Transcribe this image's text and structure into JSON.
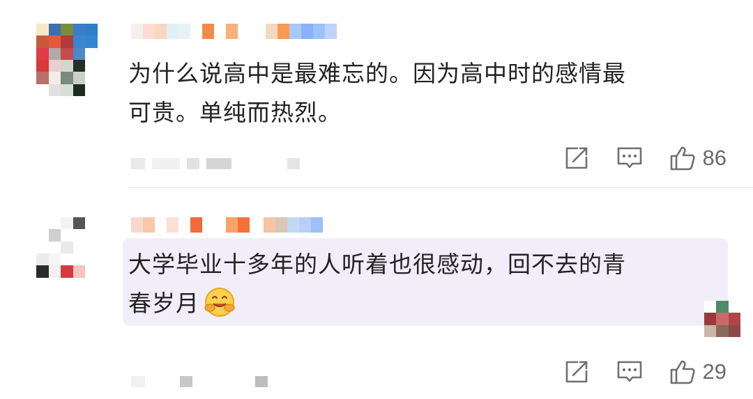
{
  "comments": [
    {
      "text_line1": "为什么说高中是最难忘的。因为高中时的感情最",
      "text_line2": "可贵。单纯而热烈。",
      "likes": "86",
      "icons": {
        "share": "share-icon",
        "reply": "comment-icon",
        "like": "thumbs-up-icon"
      }
    },
    {
      "text_line1": "大学毕业十多年的人听着也很感动，回不去的青",
      "text_line2": "春岁月",
      "emoji": "hugging-face-emoji",
      "likes": "29",
      "icons": {
        "share": "share-icon",
        "reply": "comment-icon",
        "like": "thumbs-up-icon"
      }
    }
  ],
  "colors": {
    "text": "#222222",
    "icon": "#6f6f6f",
    "highlight_bg": "#f1eef9",
    "divider": "#eeeeee"
  }
}
